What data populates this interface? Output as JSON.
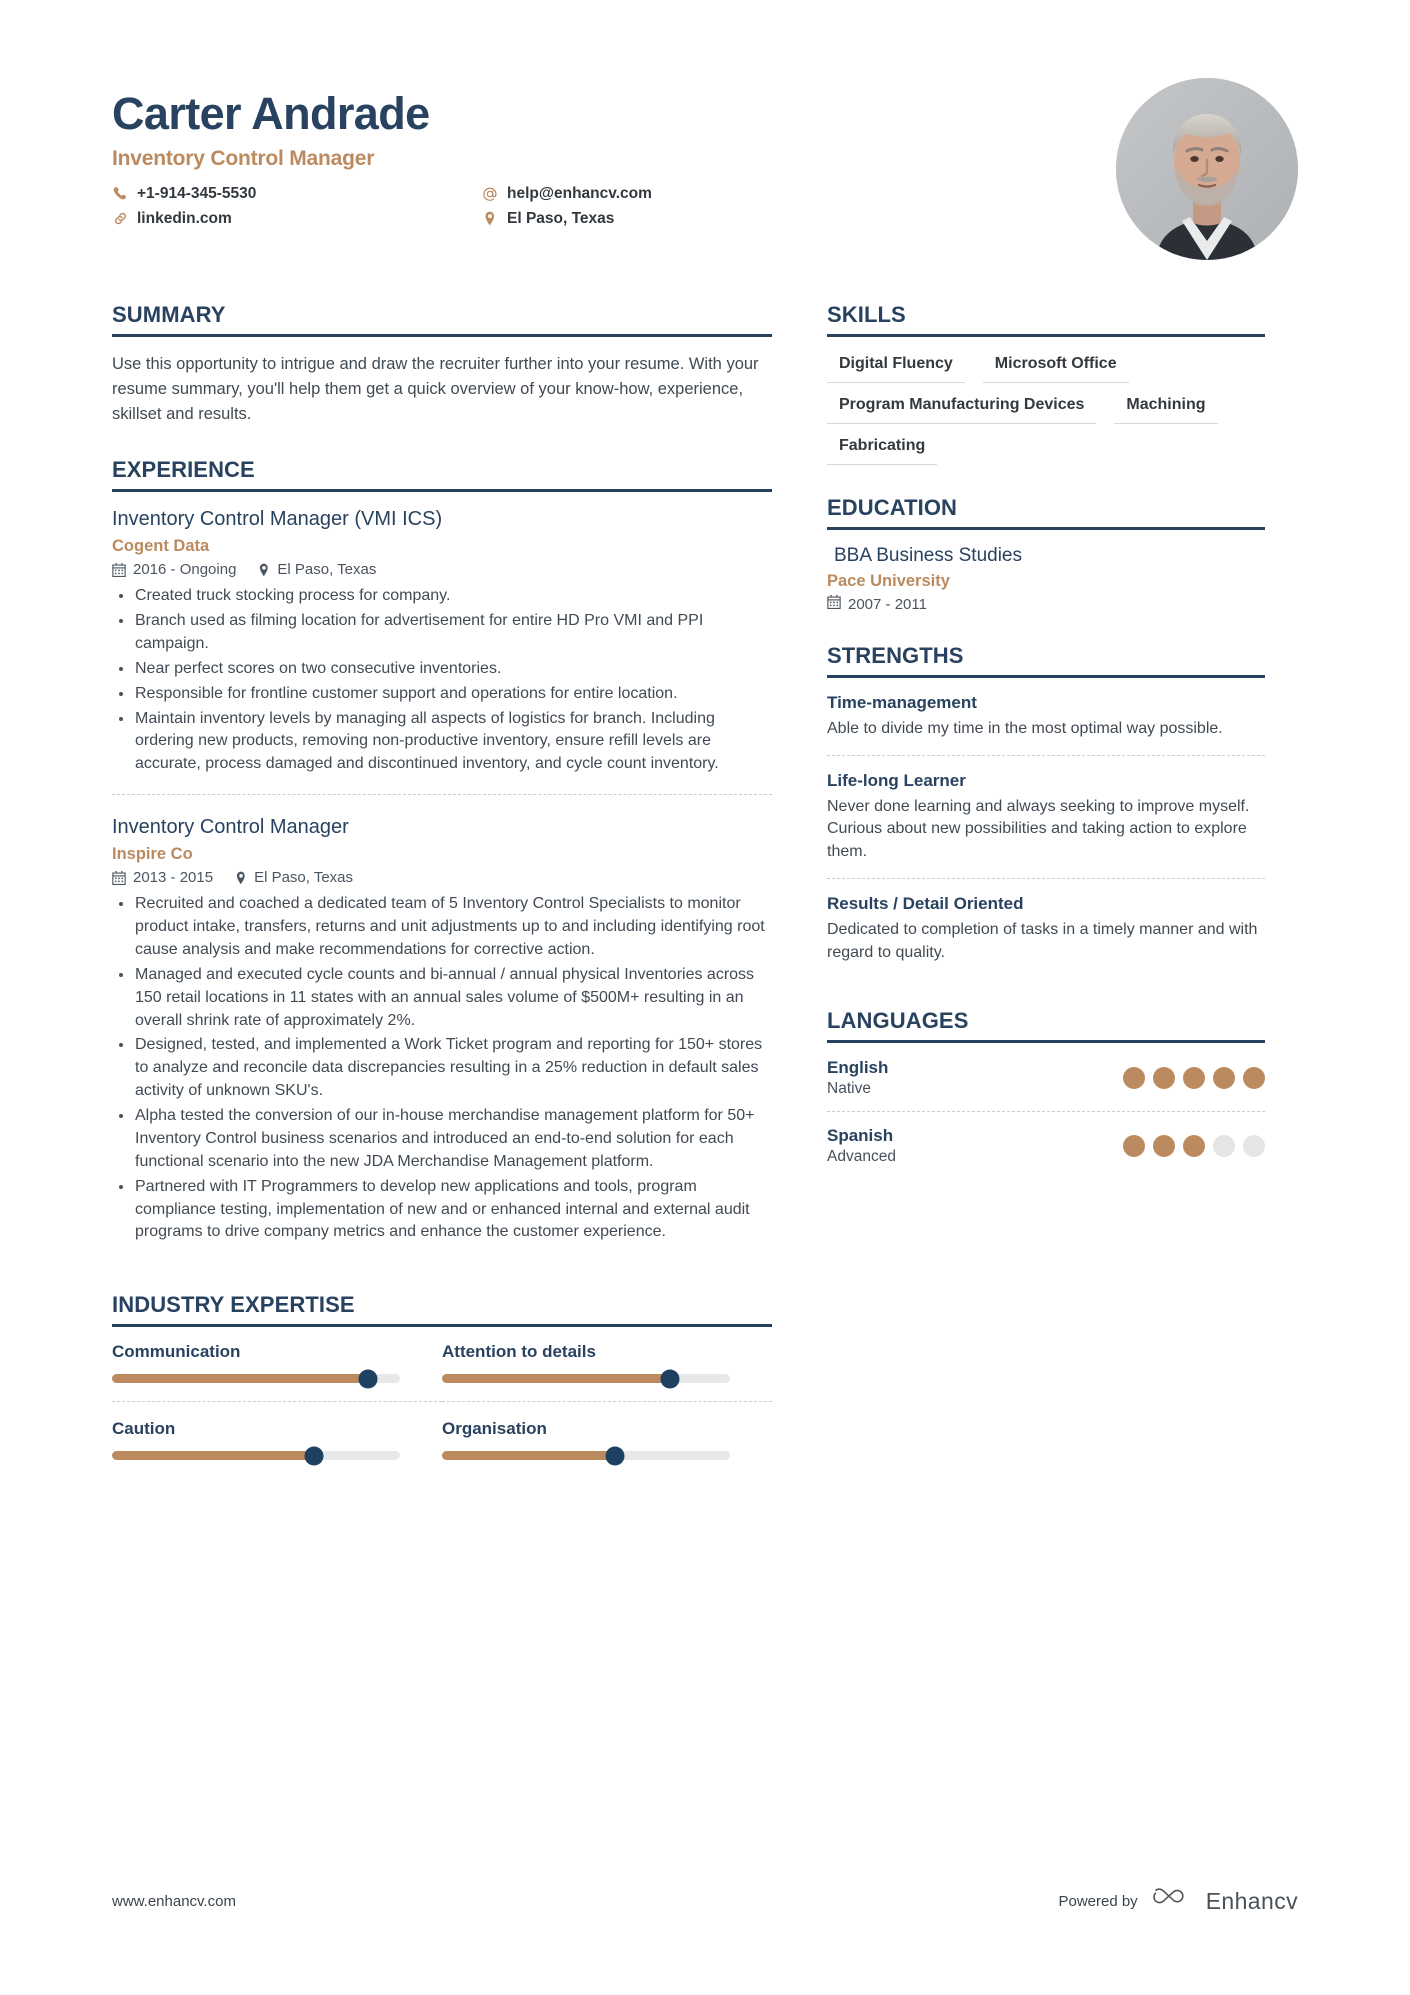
{
  "header": {
    "full_name": "Carter Andrade",
    "job_title": "Inventory Control Manager",
    "contacts_left": [
      {
        "icon": "phone-icon",
        "text": "+1-914-345-5530"
      },
      {
        "icon": "link-icon",
        "text": "linkedin.com"
      }
    ],
    "contacts_right": [
      {
        "icon": "at-icon",
        "text": "help@enhancv.com"
      },
      {
        "icon": "location-icon",
        "text": "El Paso, Texas"
      }
    ],
    "avatar_alt": "profile-photo"
  },
  "summary": {
    "title": "SUMMARY",
    "text": "Use this opportunity to intrigue and draw the recruiter further into your resume. With your resume summary, you'll help them get a quick overview of your know-how, experience, skillset and results."
  },
  "experience": {
    "title": "EXPERIENCE",
    "jobs": [
      {
        "role": "Inventory Control Manager (VMI ICS)",
        "company": "Cogent Data",
        "dates": "2016 - Ongoing",
        "location": "El Paso, Texas",
        "bullets": [
          "Created truck stocking process for company.",
          "Branch used as filming location for advertisement for entire HD Pro VMI and PPI campaign.",
          "Near perfect scores on two consecutive inventories.",
          "Responsible for frontline customer support and operations for entire location.",
          "Maintain inventory levels by managing all aspects of logistics for branch. Including ordering new products, removing non-productive inventory, ensure refill levels are accurate, process damaged and discontinued inventory, and cycle count inventory."
        ]
      },
      {
        "role": "Inventory Control Manager",
        "company": "Inspire Co",
        "dates": "2013 - 2015",
        "location": "El Paso, Texas",
        "bullets": [
          "Recruited and coached a dedicated team of 5 Inventory Control Specialists to monitor product intake, transfers, returns and unit adjustments up to and including identifying root cause analysis and make recommendations for corrective action.",
          "Managed and executed cycle counts and bi-annual / annual physical Inventories across 150 retail locations in 11 states with an annual sales volume of $500M+ resulting in an overall shrink rate of approximately 2%.",
          "Designed, tested, and implemented a Work Ticket program and reporting for 150+ stores to analyze and reconcile data discrepancies resulting in a 25% reduction in default sales activity of unknown SKU's.",
          "Alpha tested the conversion of our in-house merchandise management platform for 50+ Inventory Control business scenarios and introduced an end-to-end solution for each functional scenario into the new JDA Merchandise Management platform.",
          "Partnered with IT Programmers to develop new applications and tools, program compliance testing, implementation of new and or enhanced internal and external audit programs to drive company metrics and enhance the customer experience."
        ]
      }
    ]
  },
  "industry_expertise": {
    "title": "INDUSTRY EXPERTISE",
    "items": [
      {
        "label": "Communication",
        "value": 89
      },
      {
        "label": "Attention to details",
        "value": 79
      },
      {
        "label": "Caution",
        "value": 70
      },
      {
        "label": "Organisation",
        "value": 60
      }
    ]
  },
  "skills": {
    "title": "SKILLS",
    "items": [
      "Digital Fluency",
      "Microsoft Office",
      "Program Manufacturing Devices",
      "Machining",
      "Fabricating"
    ]
  },
  "education": {
    "title": "EDUCATION",
    "entries": [
      {
        "degree": "BBA Business Studies",
        "school": "Pace University",
        "dates": "2007 - 2011"
      }
    ]
  },
  "strengths": {
    "title": "STRENGTHS",
    "items": [
      {
        "name": "Time-management",
        "description": "Able to divide my time in the most optimal way possible."
      },
      {
        "name": "Life-long Learner",
        "description": "Never done learning and always seeking to improve myself. Curious about new possibilities and taking action to explore them."
      },
      {
        "name": "Results / Detail Oriented",
        "description": "Dedicated to completion of tasks in a timely manner and with regard to quality."
      }
    ]
  },
  "languages": {
    "title": "LANGUAGES",
    "max_dots": 5,
    "items": [
      {
        "name": "English",
        "level": "Native",
        "filled": 5
      },
      {
        "name": "Spanish",
        "level": "Advanced",
        "filled": 3
      }
    ]
  },
  "footer": {
    "url": "www.enhancv.com",
    "powered_by": "Powered by",
    "brand_name": "Enhancv",
    "brand_icon": "enhancv-logo-icon"
  },
  "colors": {
    "navy": "#28425f",
    "bronze": "#bb8a5f",
    "body_text": "#414a53",
    "track": "#e6e8ea",
    "knob": "#1f4161"
  }
}
